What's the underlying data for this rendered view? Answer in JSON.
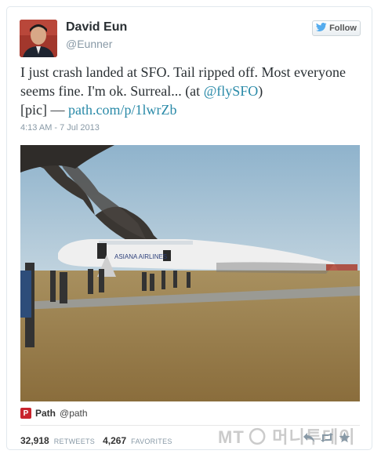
{
  "author": {
    "display_name": "David Eun",
    "handle": "@Eunner"
  },
  "follow_button": {
    "label": "Follow"
  },
  "tweet": {
    "text_before": "I just crash landed at SFO. Tail ripped off. Most everyone seems fine. I'm ok. Surreal... (at ",
    "mention": "@flySFO",
    "text_mid": ")",
    "text_pic": " [pic] — ",
    "link": "path.com/p/1lwrZb",
    "timestamp": "4:13 AM - 7 Jul 2013"
  },
  "photo": {
    "caption": "ASIANA AIRLINES"
  },
  "source": {
    "name": "Path",
    "handle": "@path"
  },
  "stats": {
    "retweets_count": "32,918",
    "retweets_label": "RETWEETS",
    "favorites_count": "4,267",
    "favorites_label": "FAVORITES"
  },
  "watermark": {
    "text": "MT 〇 머니투데이"
  },
  "colors": {
    "link": "#2a8aa8",
    "path_red": "#c8232c",
    "smoke": "#3a3632"
  },
  "icons": [
    "bird-icon",
    "path-logo-icon",
    "reply-icon",
    "retweet-icon",
    "favorite-icon"
  ]
}
